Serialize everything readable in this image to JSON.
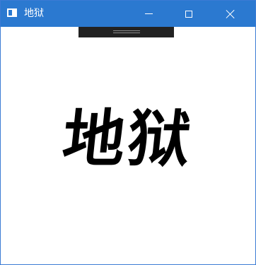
{
  "window": {
    "title": "地狱",
    "controls": {
      "minimize": "minimize",
      "maximize": "maximize",
      "close": "close"
    }
  },
  "content": {
    "text": "地狱"
  },
  "colors": {
    "titlebar": "#2b79d0",
    "text": "#000000",
    "handle": "#222222"
  }
}
